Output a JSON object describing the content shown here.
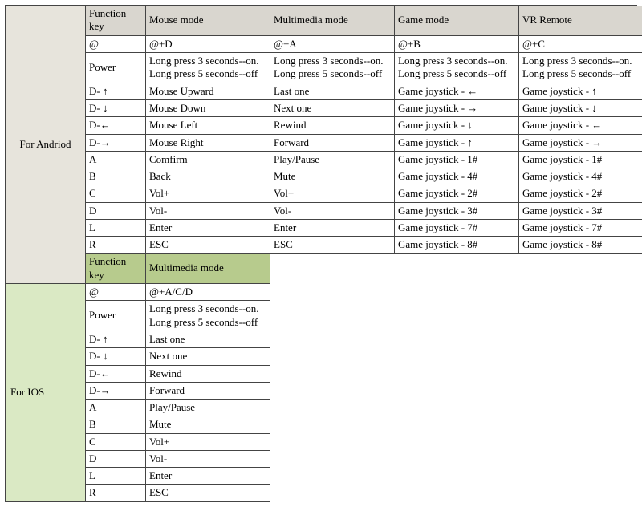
{
  "chart_data": {
    "type": "table",
    "title": "",
    "sections": [
      {
        "label": "For Andriod",
        "columns": [
          "Function key",
          "Mouse mode",
          "Multimedia mode",
          "Game mode",
          "VR Remote"
        ],
        "rows": [
          [
            "@",
            "@+D",
            "@+A",
            "@+B",
            "@+C"
          ],
          [
            "Power",
            "Long press 3 seconds--on.\nLong press 5 seconds--off",
            "Long press 3 seconds--on.\nLong press 5 seconds--off",
            "Long press 3 seconds--on.\nLong press 5 seconds--off",
            "Long press 3 seconds--on.\nLong press 5 seconds--off"
          ],
          [
            "D- ↑",
            "Mouse Upward",
            "Last one",
            "Game joystick - ←",
            "Game joystick - ↑"
          ],
          [
            "D- ↓",
            "Mouse Down",
            "Next one",
            "Game joystick - →",
            "Game joystick - ↓"
          ],
          [
            "D-←",
            "Mouse Left",
            "Rewind",
            "Game joystick - ↓",
            "Game joystick - ←"
          ],
          [
            "D-→",
            "Mouse Right",
            "Forward",
            "Game joystick - ↑",
            "Game joystick - →"
          ],
          [
            "A",
            "Comfirm",
            "Play/Pause",
            "Game joystick - 1#",
            "Game joystick - 1#"
          ],
          [
            "B",
            "Back",
            "Mute",
            "Game joystick - 4#",
            "Game joystick - 4#"
          ],
          [
            "C",
            "Vol+",
            "Vol+",
            "Game joystick - 2#",
            "Game joystick - 2#"
          ],
          [
            "D",
            "Vol-",
            "Vol-",
            "Game joystick - 3#",
            "Game joystick - 3#"
          ],
          [
            "L",
            "Enter",
            "Enter",
            "Game joystick - 7#",
            "Game joystick - 7#"
          ],
          [
            "R",
            "ESC",
            "ESC",
            "Game joystick - 8#",
            "Game joystick - 8#"
          ]
        ]
      },
      {
        "label": "For IOS",
        "columns": [
          "Function key",
          "Multimedia mode"
        ],
        "rows": [
          [
            "@",
            "@+A/C/D"
          ],
          [
            "Power",
            "Long press 3 seconds--on.\nLong press 5 seconds--off"
          ],
          [
            "D- ↑",
            "Last one"
          ],
          [
            "D- ↓",
            "Next one"
          ],
          [
            "D-←",
            "Rewind"
          ],
          [
            "D-→",
            "Forward"
          ],
          [
            "A",
            "Play/Pause"
          ],
          [
            "B",
            "Mute"
          ],
          [
            "C",
            "Vol+"
          ],
          [
            "D",
            "Vol-"
          ],
          [
            "L",
            "Enter"
          ],
          [
            "R",
            "ESC"
          ]
        ]
      }
    ]
  }
}
